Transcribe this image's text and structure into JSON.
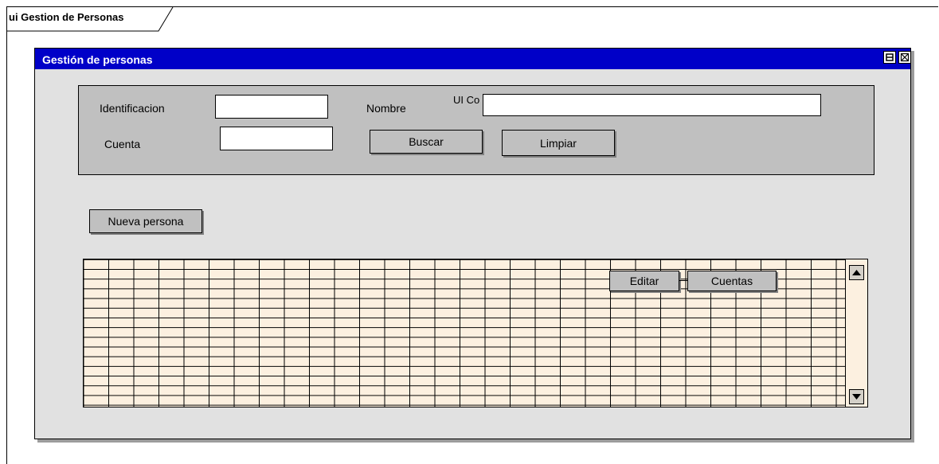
{
  "frame": {
    "label": "ui Gestion de Personas"
  },
  "window": {
    "title": "Gestión de personas",
    "controls": [
      {
        "name": "restore-icon"
      },
      {
        "name": "close-icon"
      }
    ]
  },
  "search": {
    "identificacion_label": "Identificacion",
    "identificacion_value": "",
    "nombre_label": "Nombre",
    "nombre_value": "",
    "cuenta_label": "Cuenta",
    "cuenta_value": "",
    "overlap_label": "UI Co",
    "buscar_label": "Buscar",
    "limpiar_label": "Limpiar"
  },
  "actions": {
    "nueva_persona_label": "Nueva persona"
  },
  "grid": {
    "editar_label": "Editar",
    "cuentas_label": "Cuentas",
    "scroll_up_icon": "arrow-up-icon",
    "scroll_down_icon": "arrow-down-icon"
  },
  "colors": {
    "titlebar": "#0000c8",
    "window_bg": "#e1e1e1",
    "panel_bg": "#c0c0c0",
    "grid_bg": "#fcf0e0"
  }
}
